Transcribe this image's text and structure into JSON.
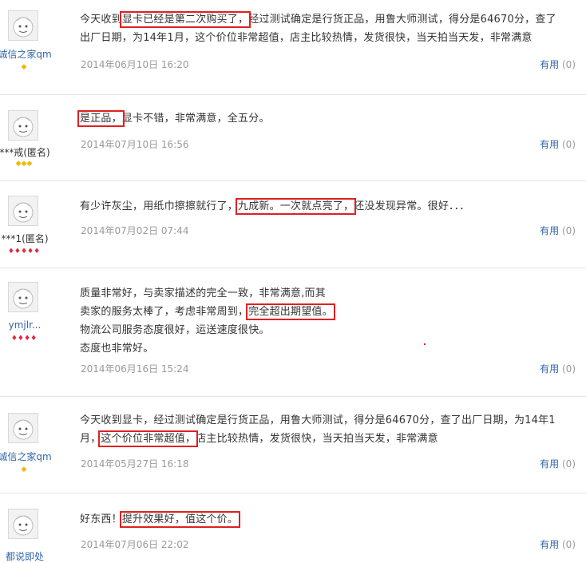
{
  "colors": {
    "link": "#3366aa",
    "highlight_box": "#e02020",
    "muted": "#999999"
  },
  "reviews": [
    {
      "user": "诚信之家qm",
      "badge": "gold",
      "badge_count": 1,
      "line1_a": "今天收到",
      "line1_hl": "显卡已经是第二次购买了，",
      "line1_b": "经过测试确定是行货正品，用鲁大师测试，得分是64670分，查了",
      "line2": "出厂日期，为14年1月，这个价位非常超值，店主比较热情，发货很快，当天拍当天发，非常满意",
      "date": "2014年06月10日 16:20",
      "useful": "有用",
      "count": "(0)"
    },
    {
      "user": "***戒(匿名)",
      "badge": "gold",
      "badge_count": 3,
      "hl": "是正品，",
      "rest": "显卡不错，非常满意，全五分。",
      "date": "2014年07月10日 16:56",
      "useful": "有用",
      "count": "(0)"
    },
    {
      "user": "***1(匿名)",
      "badge": "red",
      "badge_count": 5,
      "a": "有少许灰尘，用纸巾擦擦就行了，",
      "hl": "九成新。一次就点亮了，",
      "b": "还没发现异常。很好．．．",
      "date": "2014年07月02日 07:44",
      "useful": "有用",
      "count": "(0)"
    },
    {
      "user": "ymjlr...",
      "badge": "red",
      "badge_count": 4,
      "l1": "质量非常好，与卖家描述的完全一致，非常满意,而其",
      "l2a": "卖家的服务太棒了，考虑非常周到，",
      "l2hl": "完全超出期望值。",
      "l3": "物流公司服务态度很好，运送速度很快。",
      "l4": "态度也非常好。",
      "date": "2014年06月16日 15:24",
      "useful": "有用",
      "count": "(0)"
    },
    {
      "user": "诚信之家qm",
      "badge": "gold",
      "badge_count": 1,
      "l1": "今天收到显卡，经过测试确定是行货正品，用鲁大师测试，得分是64670分，查了出厂日期，为14年1",
      "l2a": "月，",
      "l2hl": "这个价位非常超值，",
      "l2b": "店主比较热情，发货很快，当天拍当天发，非常满意",
      "date": "2014年05月27日 16:18",
      "useful": "有用",
      "count": "(0)"
    },
    {
      "user": "都说即处",
      "a": "好东西！",
      "hl": "提升效果好，值这个价。",
      "date": "2014年07月06日 22:02",
      "useful": "有用",
      "count": "(0)"
    }
  ]
}
